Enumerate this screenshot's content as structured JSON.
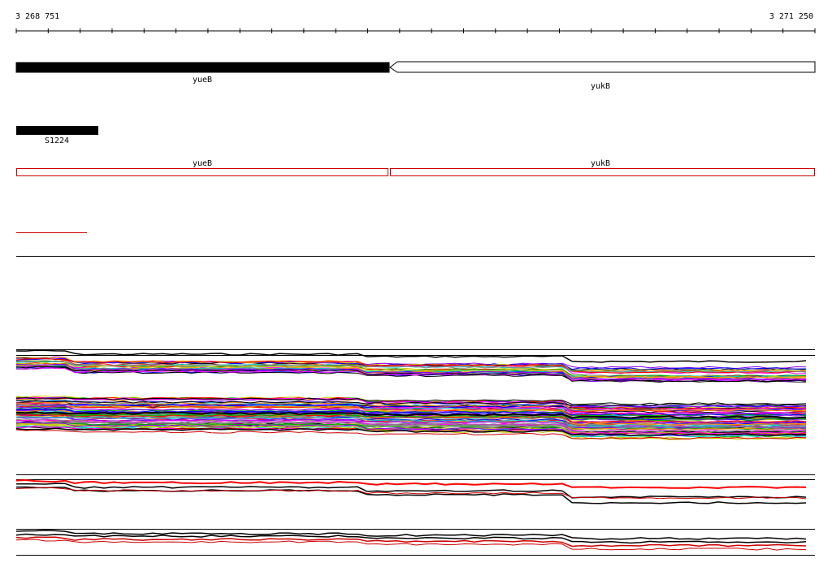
{
  "ruler": {
    "start_label": "3 268 751",
    "end_label": "3 271 250"
  },
  "genes": [
    {
      "name": "yueB",
      "strand": "+",
      "style": "filled"
    },
    {
      "name": "yukB",
      "strand": "-",
      "style": "open"
    }
  ],
  "features": [
    {
      "name": "S1224"
    }
  ],
  "transcripts": [
    {
      "name": "yueB"
    },
    {
      "name": "yukB"
    }
  ],
  "colors": {
    "gene_fill": "#000000",
    "transcript_outline": "#cc0000",
    "track_palette": [
      "#ff0000",
      "#00aa00",
      "#0000ff",
      "#ff00ff",
      "#00cccc",
      "#cccc00",
      "#ff8800",
      "#888888",
      "#000000",
      "#8800ff"
    ]
  }
}
